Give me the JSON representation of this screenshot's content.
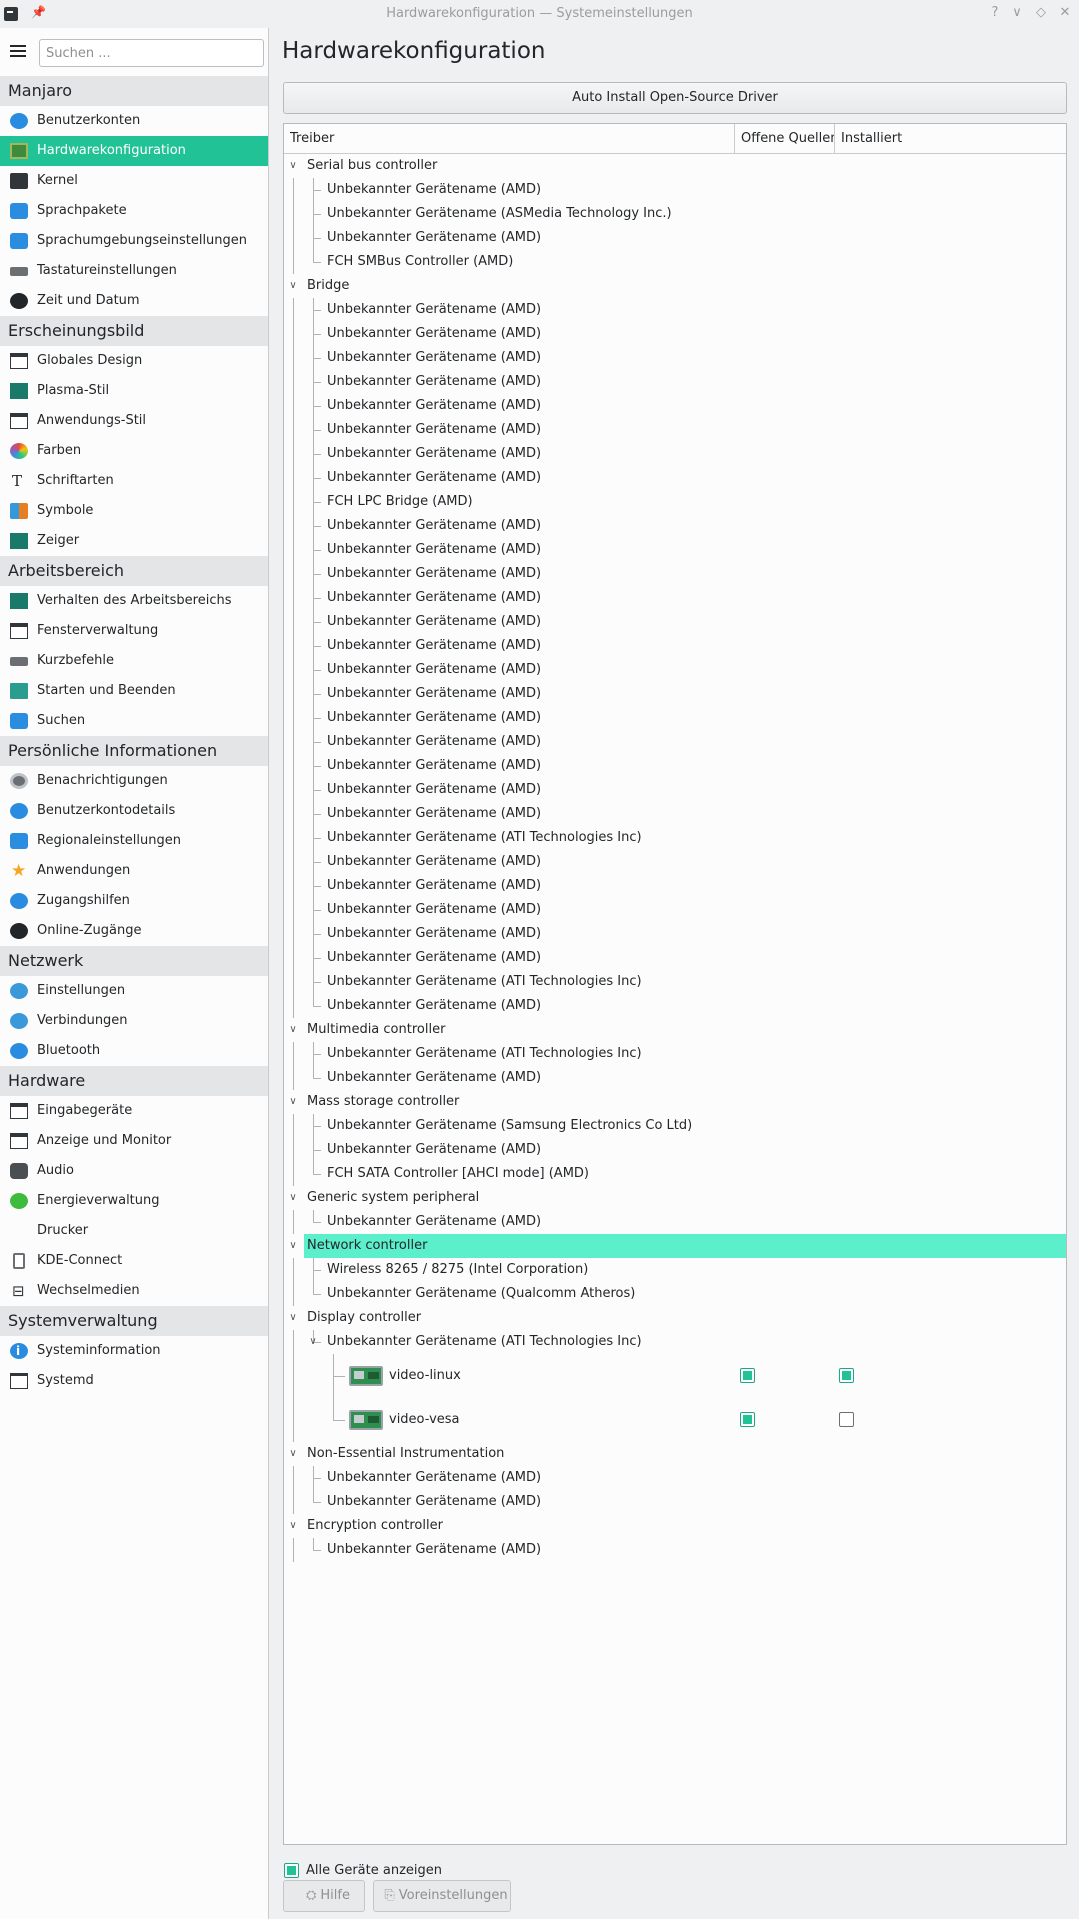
{
  "window": {
    "title": "Hardwarekonfiguration — Systemeinstellungen",
    "buttons": [
      "?",
      "∨",
      "◇",
      "✕"
    ]
  },
  "sidebar": {
    "search_placeholder": "Suchen ...",
    "categories": [
      {
        "name": "Manjaro",
        "items": [
          {
            "label": "Benutzerkonten",
            "icon": "user-accounts-icon",
            "active": false
          },
          {
            "label": "Hardwarekonfiguration",
            "icon": "hardware-board-icon",
            "active": true
          },
          {
            "label": "Kernel",
            "icon": "kernel-icon",
            "active": false
          },
          {
            "label": "Sprachpakete",
            "icon": "language-packs-icon",
            "active": false
          },
          {
            "label": "Sprachumgebungseinstellungen",
            "icon": "locale-icon",
            "active": false
          },
          {
            "label": "Tastatureinstellungen",
            "icon": "keyboard-icon",
            "active": false
          },
          {
            "label": "Zeit und Datum",
            "icon": "clock-icon",
            "active": false
          }
        ]
      },
      {
        "name": "Erscheinungsbild",
        "items": [
          {
            "label": "Globales Design",
            "icon": "global-theme-icon",
            "active": false
          },
          {
            "label": "Plasma-Stil",
            "icon": "plasma-style-icon",
            "active": false
          },
          {
            "label": "Anwendungs-Stil",
            "icon": "application-style-icon",
            "active": false
          },
          {
            "label": "Farben",
            "icon": "colors-icon",
            "active": false
          },
          {
            "label": "Schriftarten",
            "icon": "fonts-icon",
            "active": false
          },
          {
            "label": "Symbole",
            "icon": "symbols-icon",
            "active": false
          },
          {
            "label": "Zeiger",
            "icon": "cursor-icon",
            "active": false
          }
        ]
      },
      {
        "name": "Arbeitsbereich",
        "items": [
          {
            "label": "Verhalten des Arbeitsbereichs",
            "icon": "workspace-behavior-icon",
            "active": false
          },
          {
            "label": "Fensterverwaltung",
            "icon": "window-management-icon",
            "active": false
          },
          {
            "label": "Kurzbefehle",
            "icon": "shortcuts-icon",
            "active": false
          },
          {
            "label": "Starten und Beenden",
            "icon": "startup-shutdown-icon",
            "active": false
          },
          {
            "label": "Suchen",
            "icon": "search-icon",
            "active": false
          }
        ]
      },
      {
        "name": "Persönliche Informationen",
        "items": [
          {
            "label": "Benachrichtigungen",
            "icon": "notifications-icon",
            "active": false
          },
          {
            "label": "Benutzerkontodetails",
            "icon": "account-details-icon",
            "active": false
          },
          {
            "label": "Regionaleinstellungen",
            "icon": "regional-settings-icon",
            "active": false
          },
          {
            "label": "Anwendungen",
            "icon": "applications-star-icon",
            "active": false
          },
          {
            "label": "Zugangshilfen",
            "icon": "accessibility-icon",
            "active": false
          },
          {
            "label": "Online-Zugänge",
            "icon": "online-accounts-icon",
            "active": false
          }
        ]
      },
      {
        "name": "Netzwerk",
        "items": [
          {
            "label": "Einstellungen",
            "icon": "network-settings-icon",
            "active": false
          },
          {
            "label": "Verbindungen",
            "icon": "connections-icon",
            "active": false
          },
          {
            "label": "Bluetooth",
            "icon": "bluetooth-icon",
            "active": false
          }
        ]
      },
      {
        "name": "Hardware",
        "items": [
          {
            "label": "Eingabegeräte",
            "icon": "input-devices-icon",
            "active": false
          },
          {
            "label": "Anzeige und Monitor",
            "icon": "display-monitor-icon",
            "active": false
          },
          {
            "label": "Audio",
            "icon": "audio-icon",
            "active": false
          },
          {
            "label": "Energieverwaltung",
            "icon": "power-management-icon",
            "active": false
          },
          {
            "label": "Drucker",
            "icon": "",
            "active": false
          },
          {
            "label": "KDE-Connect",
            "icon": "kde-connect-icon",
            "active": false
          },
          {
            "label": "Wechselmedien",
            "icon": "removable-media-icon",
            "active": false
          }
        ]
      },
      {
        "name": "Systemverwaltung",
        "items": [
          {
            "label": "Systeminformation",
            "icon": "info-icon",
            "active": false
          },
          {
            "label": "Systemd",
            "icon": "systemd-icon",
            "active": false
          }
        ]
      }
    ]
  },
  "main": {
    "title": "Hardwarekonfiguration",
    "auto_install_label": "Auto Install Open-Source Driver",
    "columns": [
      "Treiber",
      "Offene Quellen",
      "Installiert"
    ],
    "tree": [
      {
        "category": "Serial bus controller",
        "devices": [
          "Unbekannter Gerätename (AMD)",
          "Unbekannter Gerätename (ASMedia Technology Inc.)",
          "Unbekannter Gerätename (AMD)",
          "FCH SMBus Controller (AMD)"
        ]
      },
      {
        "category": "Bridge",
        "devices": [
          "Unbekannter Gerätename (AMD)",
          "Unbekannter Gerätename (AMD)",
          "Unbekannter Gerätename (AMD)",
          "Unbekannter Gerätename (AMD)",
          "Unbekannter Gerätename (AMD)",
          "Unbekannter Gerätename (AMD)",
          "Unbekannter Gerätename (AMD)",
          "Unbekannter Gerätename (AMD)",
          "FCH LPC Bridge (AMD)",
          "Unbekannter Gerätename (AMD)",
          "Unbekannter Gerätename (AMD)",
          "Unbekannter Gerätename (AMD)",
          "Unbekannter Gerätename (AMD)",
          "Unbekannter Gerätename (AMD)",
          "Unbekannter Gerätename (AMD)",
          "Unbekannter Gerätename (AMD)",
          "Unbekannter Gerätename (AMD)",
          "Unbekannter Gerätename (AMD)",
          "Unbekannter Gerätename (AMD)",
          "Unbekannter Gerätename (AMD)",
          "Unbekannter Gerätename (AMD)",
          "Unbekannter Gerätename (AMD)",
          "Unbekannter Gerätename (ATI Technologies Inc)",
          "Unbekannter Gerätename (AMD)",
          "Unbekannter Gerätename (AMD)",
          "Unbekannter Gerätename (AMD)",
          "Unbekannter Gerätename (AMD)",
          "Unbekannter Gerätename (AMD)",
          "Unbekannter Gerätename (ATI Technologies Inc)",
          "Unbekannter Gerätename (AMD)"
        ]
      },
      {
        "category": "Multimedia controller",
        "devices": [
          "Unbekannter Gerätename (ATI Technologies Inc)",
          "Unbekannter Gerätename (AMD)"
        ]
      },
      {
        "category": "Mass storage controller",
        "devices": [
          "Unbekannter Gerätename (Samsung Electronics Co Ltd)",
          "Unbekannter Gerätename (AMD)",
          "FCH SATA Controller [AHCI mode] (AMD)"
        ]
      },
      {
        "category": "Generic system peripheral",
        "devices": [
          "Unbekannter Gerätename (AMD)"
        ]
      },
      {
        "category": "Network controller",
        "selected": true,
        "devices": [
          "Wireless 8265 / 8275 (Intel Corporation)",
          "Unbekannter Gerätename (Qualcomm Atheros)"
        ]
      },
      {
        "category": "Display controller",
        "devices": [
          {
            "name": "Unbekannter Gerätename (ATI Technologies Inc)",
            "drivers": [
              {
                "name": "video-linux",
                "open_source": true,
                "installed": true
              },
              {
                "name": "video-vesa",
                "open_source": true,
                "installed": false
              }
            ]
          }
        ]
      },
      {
        "category": "Non-Essential Instrumentation",
        "devices": [
          "Unbekannter Gerätename (AMD)",
          "Unbekannter Gerätename (AMD)"
        ]
      },
      {
        "category": "Encryption controller",
        "devices": [
          "Unbekannter Gerätename (AMD)"
        ]
      }
    ],
    "show_all_label": "Alle Geräte anzeigen",
    "show_all_checked": true,
    "help_label": "Hilfe",
    "defaults_label": "Voreinstellungen"
  },
  "colors": {
    "accent": "#22c297",
    "selection": "#5cefcc",
    "background": "#eff0f1"
  }
}
